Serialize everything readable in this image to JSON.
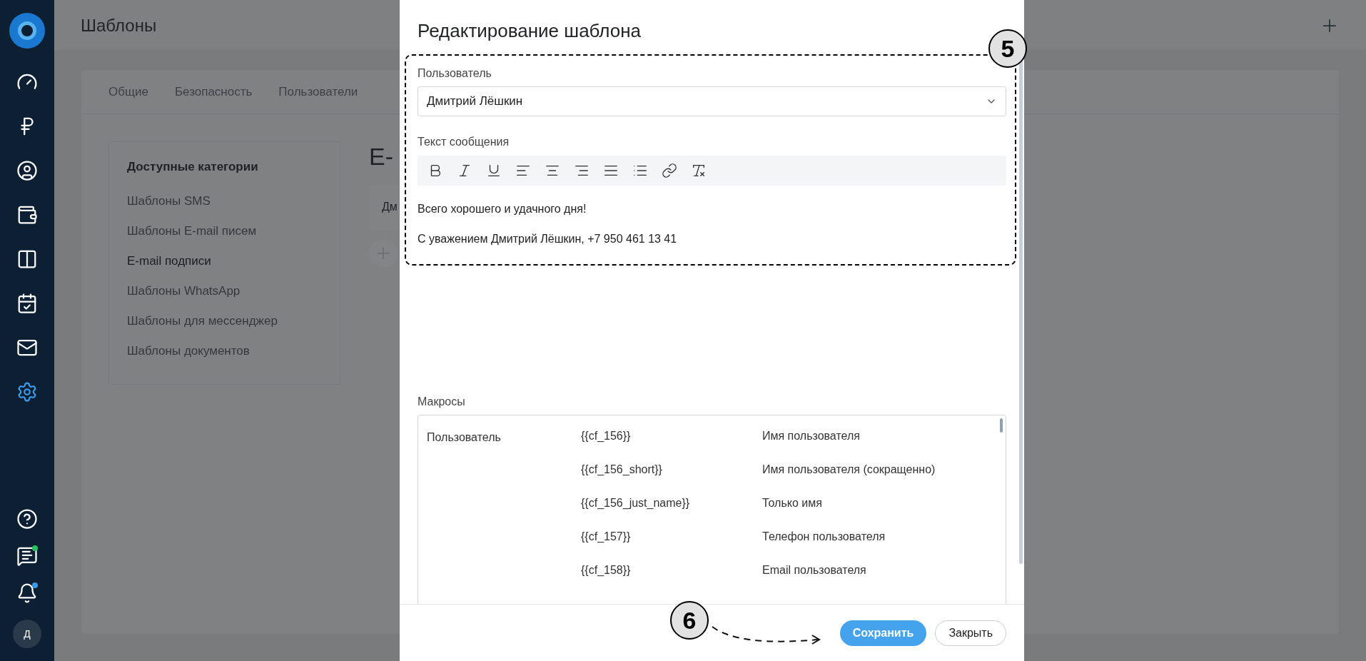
{
  "page_title": "Шаблоны",
  "nav": [
    {
      "kind": "gauge",
      "selected": false
    },
    {
      "kind": "ruble",
      "selected": false
    },
    {
      "kind": "user",
      "selected": false
    },
    {
      "kind": "wallet",
      "selected": false
    },
    {
      "kind": "columns",
      "selected": false
    },
    {
      "kind": "calendar",
      "selected": false
    },
    {
      "kind": "mail",
      "selected": false
    },
    {
      "kind": "settings",
      "selected": true
    }
  ],
  "nav_bottom": [
    {
      "kind": "help"
    },
    {
      "kind": "chat",
      "color": "#22c55e"
    },
    {
      "kind": "bell",
      "color": "#3b9ae8"
    }
  ],
  "avatar": "Д",
  "tabs": [
    {
      "label": "Общие",
      "selected": false
    },
    {
      "label": "Безопасность",
      "selected": false
    },
    {
      "label": "Пользователи",
      "selected": false
    }
  ],
  "categories": {
    "title": "Доступные категории",
    "items": [
      {
        "label": "Шаблоны SMS",
        "selected": false
      },
      {
        "label": "Шаблоны E-mail писем",
        "selected": false
      },
      {
        "label": "E-mail подписи",
        "selected": true
      },
      {
        "label": "Шаблоны WhatsApp",
        "selected": false
      },
      {
        "label": "Шаблоны для мессенджер",
        "selected": false
      },
      {
        "label": "Шаблоны документов",
        "selected": false
      }
    ]
  },
  "section_heading": "E-",
  "list_row": "Дм",
  "dialog": {
    "title": "Редактирование шаблона",
    "user_label": "Пользователь",
    "user_value": "Дмитрий Лёшкин",
    "text_label": "Текст сообщения",
    "toolbar": [
      {
        "kind": "bold"
      },
      {
        "kind": "italic"
      },
      {
        "kind": "underline"
      },
      {
        "kind": "align-left"
      },
      {
        "kind": "align-center"
      },
      {
        "kind": "align-right"
      },
      {
        "kind": "justify"
      },
      {
        "kind": "list"
      },
      {
        "kind": "link"
      },
      {
        "kind": "clear-format"
      }
    ],
    "message": [
      "Всего хорошего и удачного дня!",
      "С уважением Дмитрий Лёшкин, +7 950 461 13 41"
    ],
    "macros_label": "Макросы",
    "macros": [
      {
        "group": "Пользователь",
        "code": "{{cf_156}}",
        "description": "Имя пользователя"
      },
      {
        "code": "{{cf_156_short}}",
        "description": "Имя пользователя (сокращенно)"
      },
      {
        "code": "{{cf_156_just_name}}",
        "description": "Только имя"
      },
      {
        "code": "{{cf_157}}",
        "description": "Телефон пользователя"
      },
      {
        "code": "{{cf_158}}",
        "description": "Email пользователя"
      }
    ],
    "buttons": [
      {
        "label": "Сохранить",
        "kind": "primary"
      },
      {
        "label": "Закрыть",
        "kind": "secondary"
      }
    ]
  },
  "callouts": [
    "5",
    "6"
  ]
}
